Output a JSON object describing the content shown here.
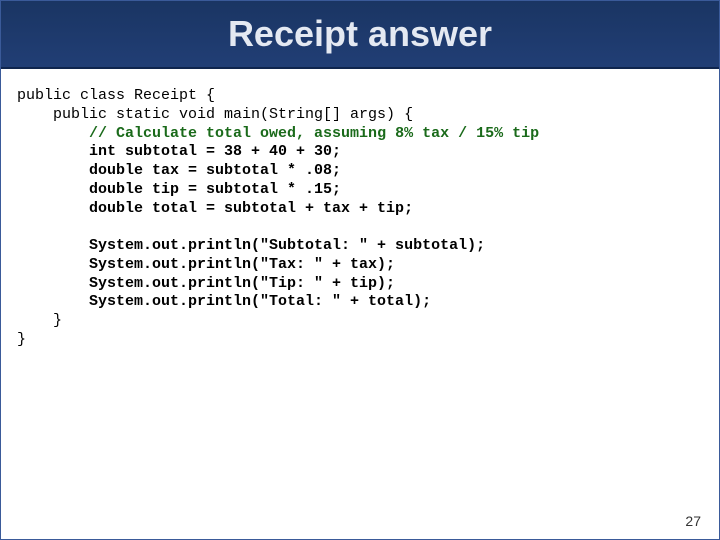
{
  "title": "Receipt answer",
  "page_number": "27",
  "code": {
    "l1": "public class Receipt {",
    "l2": "    public static void main(String[] args) {",
    "l3p": "        ",
    "l3": "// Calculate total owed, assuming 8% tax / 15% tip",
    "l4": "        int subtotal = 38 + 40 + 30;",
    "l5": "        double tax = subtotal * .08;",
    "l6": "        double tip = subtotal * .15;",
    "l7": "        double total = subtotal + tax + tip;",
    "l8": "",
    "l9": "        System.out.println(\"Subtotal: \" + subtotal);",
    "l10": "        System.out.println(\"Tax: \" + tax);",
    "l11": "        System.out.println(\"Tip: \" + tip);",
    "l12": "        System.out.println(\"Total: \" + total);",
    "l13": "    }",
    "l14": "}"
  }
}
